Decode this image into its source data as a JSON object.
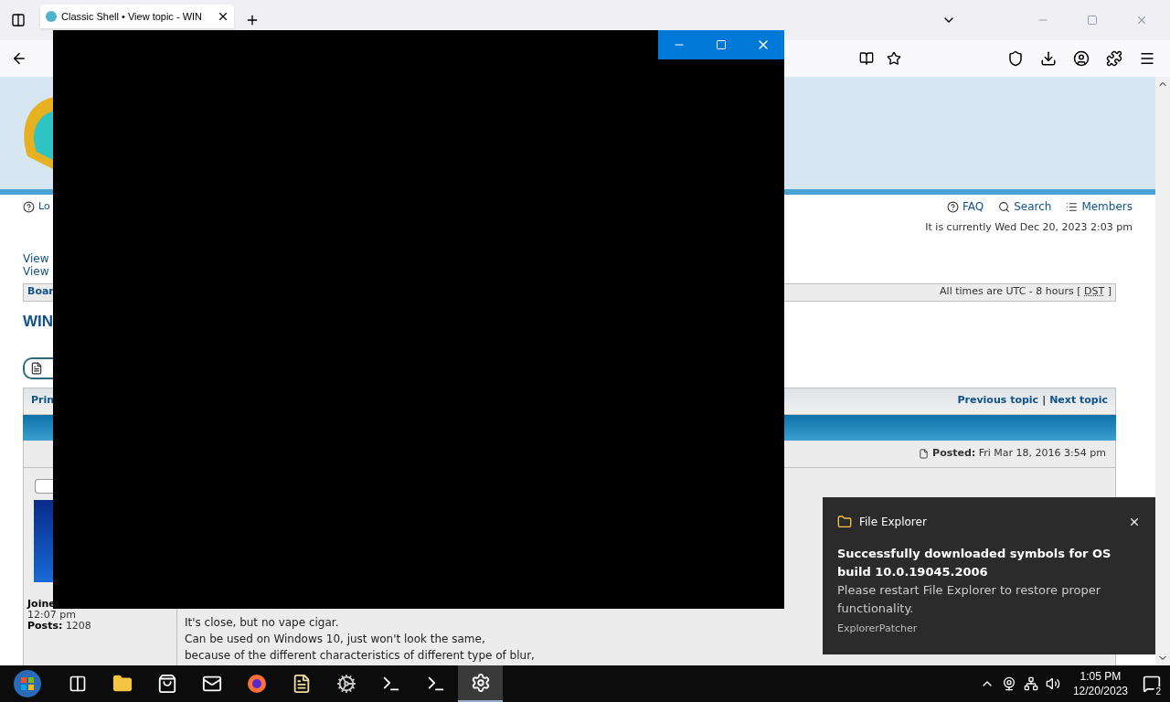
{
  "browser": {
    "tabs": [
      {
        "title": "Classic Shell • View topic - WIN",
        "selected": true
      }
    ]
  },
  "page": {
    "top_links": {
      "left": "Lo",
      "right": [
        {
          "kind": "faq",
          "label": "FAQ"
        },
        {
          "kind": "search",
          "label": "Search"
        },
        {
          "kind": "members",
          "label": "Members"
        }
      ]
    },
    "current_time": "It is currently Wed Dec 20, 2023 2:03 pm",
    "view_links": [
      "View",
      "View"
    ],
    "board_bar": {
      "left": "Boar",
      "timezone": "All times are UTC - 8 hours [",
      "dst": "DST",
      "close": "]"
    },
    "topic_title": "WIN",
    "topic_nav": {
      "left": "Prin",
      "previous": "Previous topic",
      "separator": "|",
      "next": "Next topic"
    },
    "post": {
      "posted_label": "Posted:",
      "posted_date": "Fri Mar 18, 2016 3:54 pm",
      "author": {
        "joined_label": "Joine",
        "joined_time": "12:07 pm",
        "posts_label": "Posts:",
        "posts": "1208"
      },
      "lines": [
        "It's close, but no vape cigar.",
        "Can be used on Windows 10, just won't look the same,",
        "because of the different characteristics of different type of blur,"
      ]
    }
  },
  "notification": {
    "app": "File Explorer",
    "title": "Successfully downloaded symbols for OS build 10.0.19045.2006",
    "body": "Please restart File Explorer to restore proper functionality.",
    "source": "ExplorerPatcher"
  },
  "taskbar": {
    "apps": [
      {
        "kind": "taskview",
        "selected": false
      },
      {
        "kind": "folder",
        "selected": false
      },
      {
        "kind": "store",
        "selected": false
      },
      {
        "kind": "mail",
        "selected": false
      },
      {
        "kind": "firefox",
        "selected": false
      },
      {
        "kind": "notepad",
        "selected": false
      },
      {
        "kind": "gear-dark",
        "selected": false
      },
      {
        "kind": "terminal",
        "selected": false
      },
      {
        "kind": "terminal",
        "selected": false
      },
      {
        "kind": "settings",
        "selected": true
      }
    ],
    "time": "1:05 PM",
    "date": "12/20/2023",
    "notification_count": "2"
  }
}
